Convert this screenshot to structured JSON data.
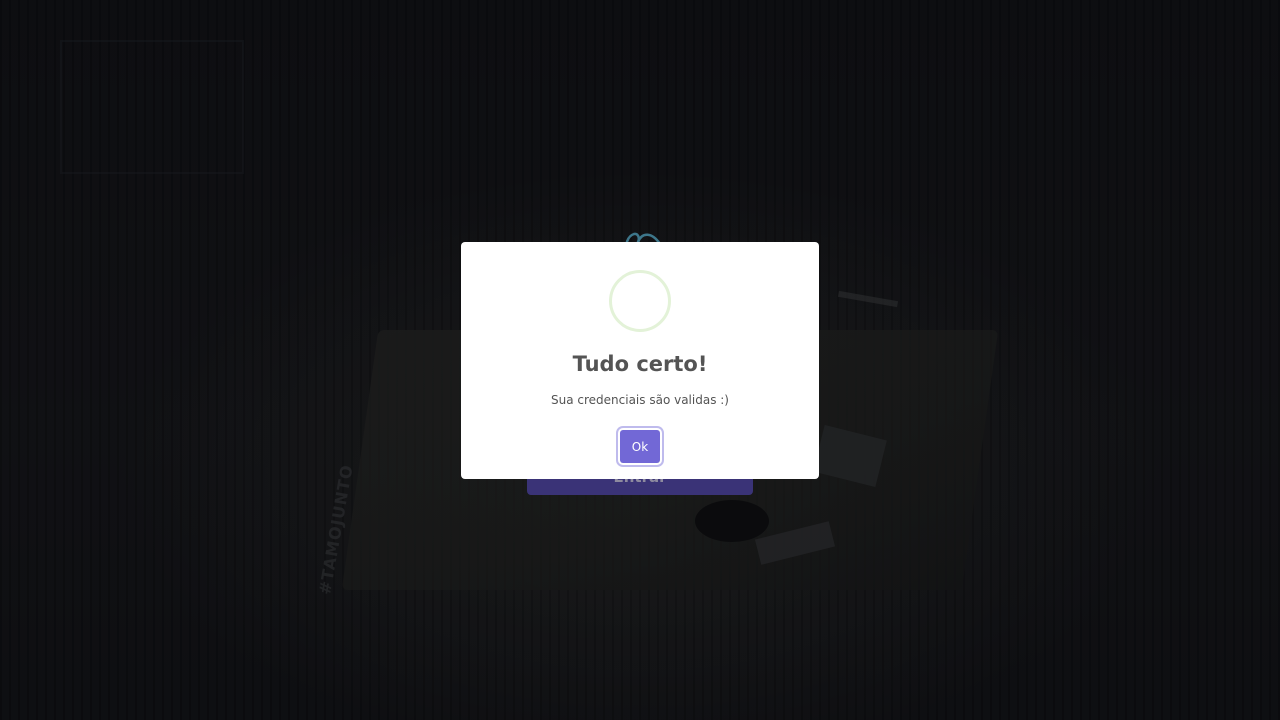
{
  "background": {
    "sticker_text": "#TAMOJUNTO"
  },
  "login": {
    "submit_label": "Entrar"
  },
  "modal": {
    "title": "Tudo certo!",
    "message": "Sua credenciais são validas :)",
    "confirm_label": "Ok",
    "icon": "success-icon"
  },
  "colors": {
    "accent": "#7268d6",
    "success_ring": "#e3f2d8",
    "text": "#545454"
  }
}
